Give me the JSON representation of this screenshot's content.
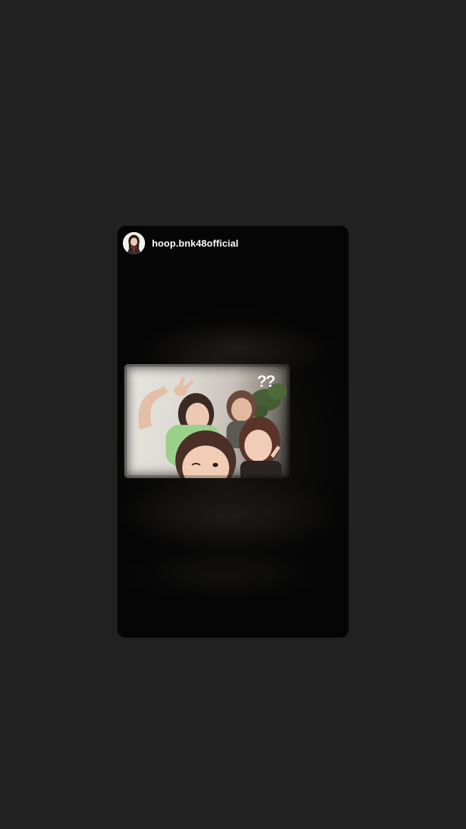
{
  "story": {
    "username": "hoop.bnk48official",
    "sticker_text": "??"
  },
  "icons": {
    "avatar": "profile-avatar"
  },
  "colors": {
    "background": "#212121",
    "card": "#050505",
    "username_text": "#ffffff"
  }
}
